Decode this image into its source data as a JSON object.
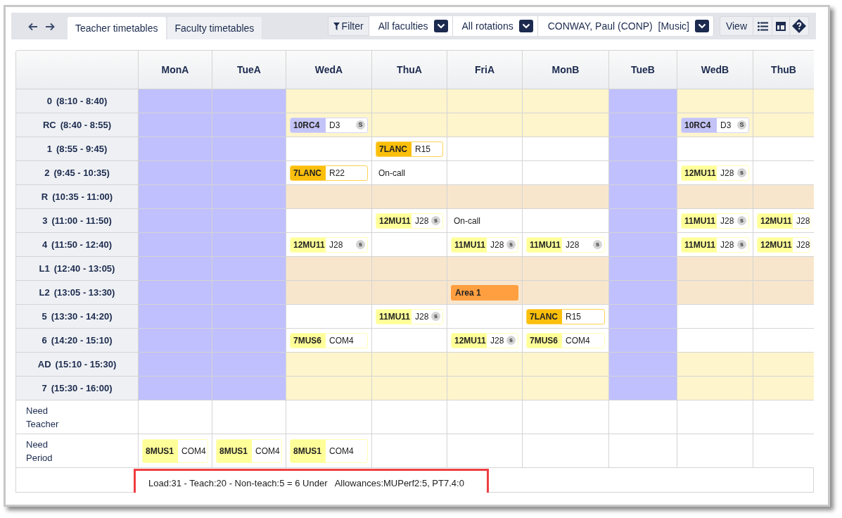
{
  "tabs": [
    {
      "label": "Teacher timetables",
      "selected": true
    },
    {
      "label": "Faculty timetables",
      "selected": false
    }
  ],
  "filter": {
    "label": "Filter"
  },
  "dropdowns": [
    {
      "value": "All faculties"
    },
    {
      "value": "All rotations"
    },
    {
      "value": "CONWAY, Paul (CONP)  [Music]"
    }
  ],
  "view": {
    "label": "View"
  },
  "columns": [
    {
      "label": "MonA",
      "off": true
    },
    {
      "label": "TueA",
      "off": true
    },
    {
      "label": "WedA",
      "off": false
    },
    {
      "label": "ThuA",
      "off": false
    },
    {
      "label": "FriA",
      "off": false
    },
    {
      "label": "MonB",
      "off": false
    },
    {
      "label": "TueB",
      "off": true
    },
    {
      "label": "WedB",
      "off": false
    },
    {
      "label": "ThuB",
      "off": false
    }
  ],
  "rows": [
    {
      "label": "0",
      "time": "(8:10 - 8:40)",
      "kind": "pastoral",
      "cells": [
        null,
        null,
        null,
        null,
        null,
        null,
        null,
        null,
        null
      ]
    },
    {
      "label": "RC",
      "time": "(8:40 - 8:55)",
      "kind": "pastoral",
      "cells": [
        null,
        null,
        {
          "kind": "lesson",
          "class": "10RC4",
          "room": "D3",
          "tag": "S",
          "color": "#c3c3f7"
        },
        null,
        null,
        null,
        null,
        {
          "kind": "lesson",
          "class": "10RC4",
          "room": "D3",
          "tag": "S",
          "color": "#c3c3f7"
        },
        null
      ]
    },
    {
      "label": "1",
      "time": "(8:55 - 9:45)",
      "kind": "lesson",
      "cells": [
        null,
        null,
        null,
        {
          "kind": "lesson",
          "class": "7LANC",
          "room": "R15",
          "color": "#fbbf0c"
        },
        null,
        null,
        null,
        null,
        null
      ]
    },
    {
      "label": "2",
      "time": "(9:45 - 10:35)",
      "kind": "lesson",
      "cells": [
        null,
        null,
        {
          "kind": "lesson",
          "class": "7LANC",
          "room": "R22",
          "color": "#fbbf0c"
        },
        {
          "kind": "note",
          "text": "On-call"
        },
        null,
        null,
        null,
        {
          "kind": "lesson",
          "class": "12MU11",
          "room": "J28",
          "tag": "s",
          "color": "#ffff99"
        },
        null
      ]
    },
    {
      "label": "R",
      "time": "(10:35 - 11:00)",
      "kind": "break",
      "cells": [
        null,
        null,
        null,
        null,
        null,
        null,
        null,
        null,
        null
      ]
    },
    {
      "label": "3",
      "time": "(11:00 - 11:50)",
      "kind": "lesson",
      "cells": [
        null,
        null,
        null,
        {
          "kind": "lesson",
          "class": "12MU11",
          "room": "J28",
          "tag": "s",
          "color": "#ffff99"
        },
        {
          "kind": "note",
          "text": "On-call"
        },
        null,
        null,
        {
          "kind": "lesson",
          "class": "11MU11",
          "room": "J28",
          "tag": "s",
          "color": "#ffff99"
        },
        {
          "kind": "lesson",
          "class": "12MU11",
          "room": "J28",
          "color": "#ffff99"
        }
      ]
    },
    {
      "label": "4",
      "time": "(11:50 - 12:40)",
      "kind": "lesson",
      "cells": [
        null,
        null,
        {
          "kind": "lesson",
          "class": "12MU11",
          "room": "J28",
          "tag": "s",
          "color": "#ffff99"
        },
        null,
        {
          "kind": "lesson",
          "class": "11MU11",
          "room": "J28",
          "tag": "s",
          "color": "#ffff99"
        },
        {
          "kind": "lesson",
          "class": "11MU11",
          "room": "J28",
          "tag": "s",
          "color": "#ffff99"
        },
        null,
        {
          "kind": "lesson",
          "class": "11MU11",
          "room": "J28",
          "tag": "s",
          "color": "#ffff99"
        },
        {
          "kind": "lesson",
          "class": "12MU11",
          "room": "J28",
          "color": "#ffff99"
        }
      ]
    },
    {
      "label": "L1",
      "time": "(12:40 - 13:05)",
      "kind": "break",
      "cells": [
        null,
        null,
        null,
        null,
        null,
        null,
        null,
        null,
        null
      ]
    },
    {
      "label": "L2",
      "time": "(13:05 - 13:30)",
      "kind": "break",
      "cells": [
        null,
        null,
        null,
        null,
        {
          "kind": "area",
          "text": "Area 1",
          "color": "#ff9f40"
        },
        null,
        null,
        null,
        null
      ]
    },
    {
      "label": "5",
      "time": "(13:30 - 14:20)",
      "kind": "lesson",
      "cells": [
        null,
        null,
        null,
        {
          "kind": "lesson",
          "class": "11MU11",
          "room": "J28",
          "tag": "s",
          "color": "#ffff99"
        },
        null,
        {
          "kind": "lesson",
          "class": "7LANC",
          "room": "R15",
          "color": "#fbbf0c"
        },
        null,
        null,
        null
      ]
    },
    {
      "label": "6",
      "time": "(14:20 - 15:10)",
      "kind": "lesson",
      "cells": [
        null,
        null,
        {
          "kind": "lesson",
          "class": "7MUS6",
          "room": "COM4",
          "color": "#ffff99"
        },
        null,
        {
          "kind": "lesson",
          "class": "12MU11",
          "room": "J28",
          "tag": "s",
          "color": "#ffff99"
        },
        {
          "kind": "lesson",
          "class": "7MUS6",
          "room": "COM4",
          "color": "#ffff99"
        },
        null,
        null,
        null
      ]
    },
    {
      "label": "AD",
      "time": "(15:10 - 15:30)",
      "kind": "pastoral",
      "cells": [
        null,
        null,
        null,
        null,
        null,
        null,
        null,
        null,
        null
      ]
    },
    {
      "label": "7",
      "time": "(15:30 - 16:00)",
      "kind": "pastoral",
      "cells": [
        null,
        null,
        null,
        null,
        null,
        null,
        null,
        null,
        null
      ]
    },
    {
      "label": "Need Teacher",
      "kind": "need",
      "cells": [
        null,
        null,
        null,
        null,
        null,
        null,
        null,
        null,
        null
      ]
    },
    {
      "label": "Need Period",
      "kind": "need",
      "cells": [
        {
          "kind": "lesson",
          "class": "8MUS1",
          "room": "COM4",
          "color": "#ffff99"
        },
        {
          "kind": "lesson",
          "class": "8MUS1",
          "room": "COM4",
          "color": "#ffff99"
        },
        {
          "kind": "lesson",
          "class": "8MUS1",
          "room": "COM4",
          "color": "#ffff99"
        },
        null,
        null,
        null,
        null,
        null,
        null
      ]
    }
  ],
  "footer": {
    "text": "Load:31 - Teach:20 - Non-teach:5 = 6 Under   Allowances:MUPerf2:5, PT7.4:0"
  }
}
